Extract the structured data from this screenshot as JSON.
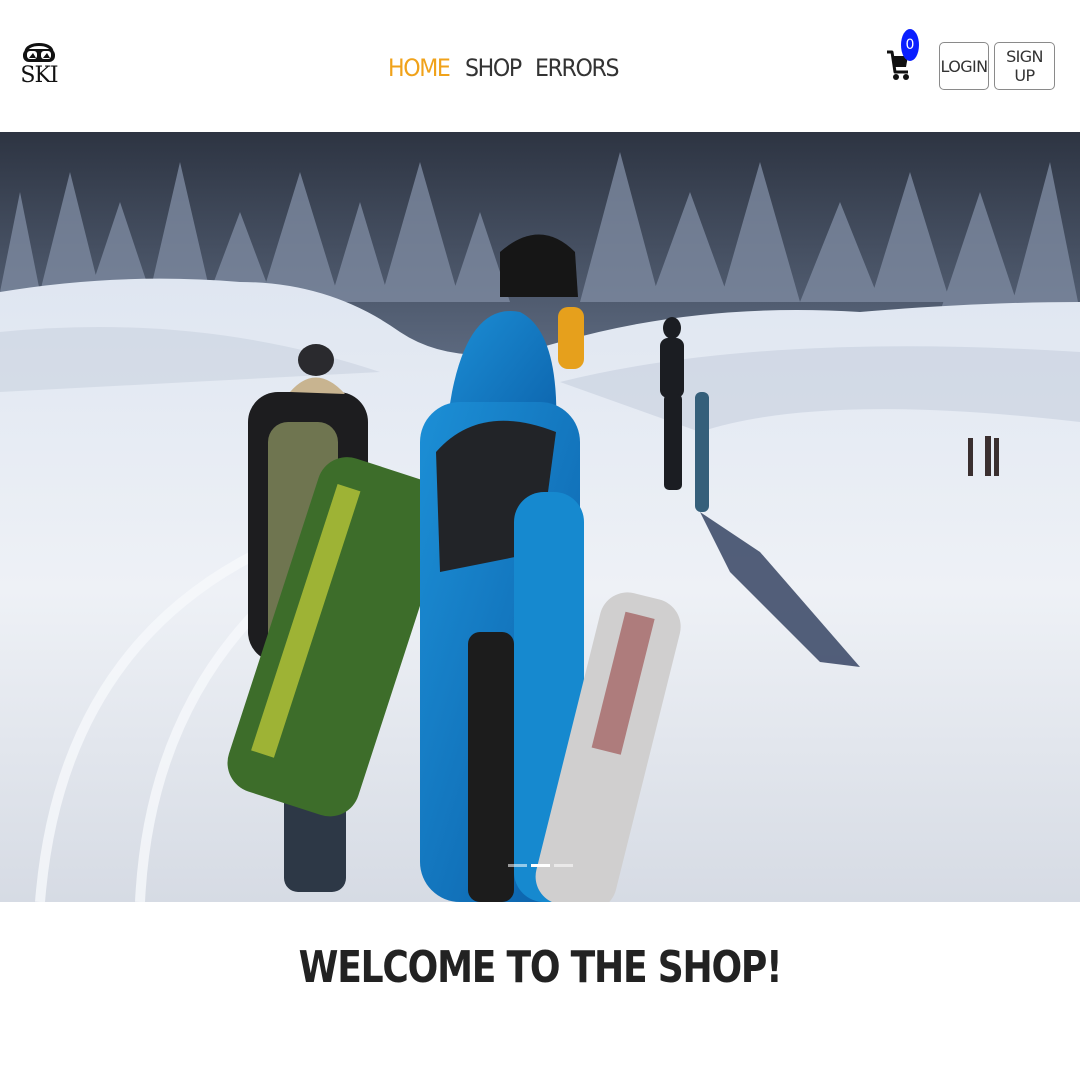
{
  "brand": {
    "logo_text": "SKI",
    "icon": "ski-goggles-logo-icon"
  },
  "nav": {
    "items": [
      {
        "label": "HOME",
        "active": true
      },
      {
        "label": "SHOP",
        "active": false
      },
      {
        "label": "ERRORS",
        "active": false
      }
    ],
    "active_color": "#f0a21a"
  },
  "cart": {
    "icon": "shopping-cart-icon",
    "count": "0",
    "badge_color": "#0a1fff"
  },
  "auth": {
    "login_label": "LOGIN",
    "signup_label": "SIGN UP"
  },
  "carousel": {
    "image": "snowboarders-walking-on-snowy-slope",
    "slides": 3,
    "active_index": 1
  },
  "welcome": {
    "heading": "WELCOME TO THE SHOP!"
  }
}
